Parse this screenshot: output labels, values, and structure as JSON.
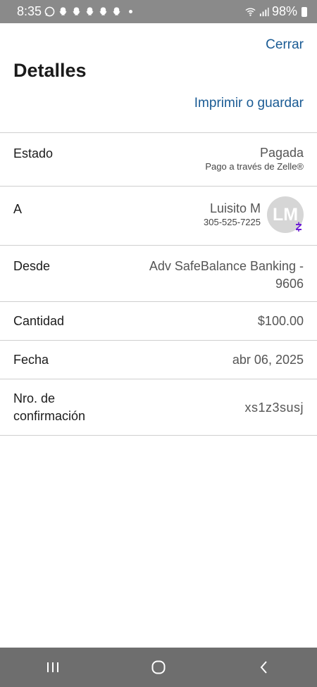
{
  "status_bar": {
    "time": "8:35",
    "battery": "98%"
  },
  "header": {
    "close_label": "Cerrar",
    "title": "Detalles",
    "print_label": "Imprimir o guardar"
  },
  "details": {
    "estado": {
      "label": "Estado",
      "value": "Pagada",
      "sub": "Pago a través de Zelle®"
    },
    "a": {
      "label": "A",
      "name": "Luisito M",
      "phone": "305-525-7225",
      "initials": "LM"
    },
    "desde": {
      "label": "Desde",
      "value": "Adv SafeBalance Banking - 9606"
    },
    "cantidad": {
      "label": "Cantidad",
      "value": "$100.00"
    },
    "fecha": {
      "label": "Fecha",
      "value": "abr 06, 2025"
    },
    "confirmacion": {
      "label": "Nro. de confirmación",
      "value": "xs1z3susj"
    }
  },
  "colors": {
    "link": "#1a5b94",
    "zelle": "#6d1ed4",
    "status_bar": "#8a8a8a",
    "nav_bar": "#6e6e6e"
  },
  "icons": [
    "whatsapp-icon",
    "snapchat-icon",
    "wifi-icon",
    "signal-icon",
    "battery-icon",
    "recents-icon",
    "home-icon",
    "back-icon",
    "zelle-icon"
  ]
}
